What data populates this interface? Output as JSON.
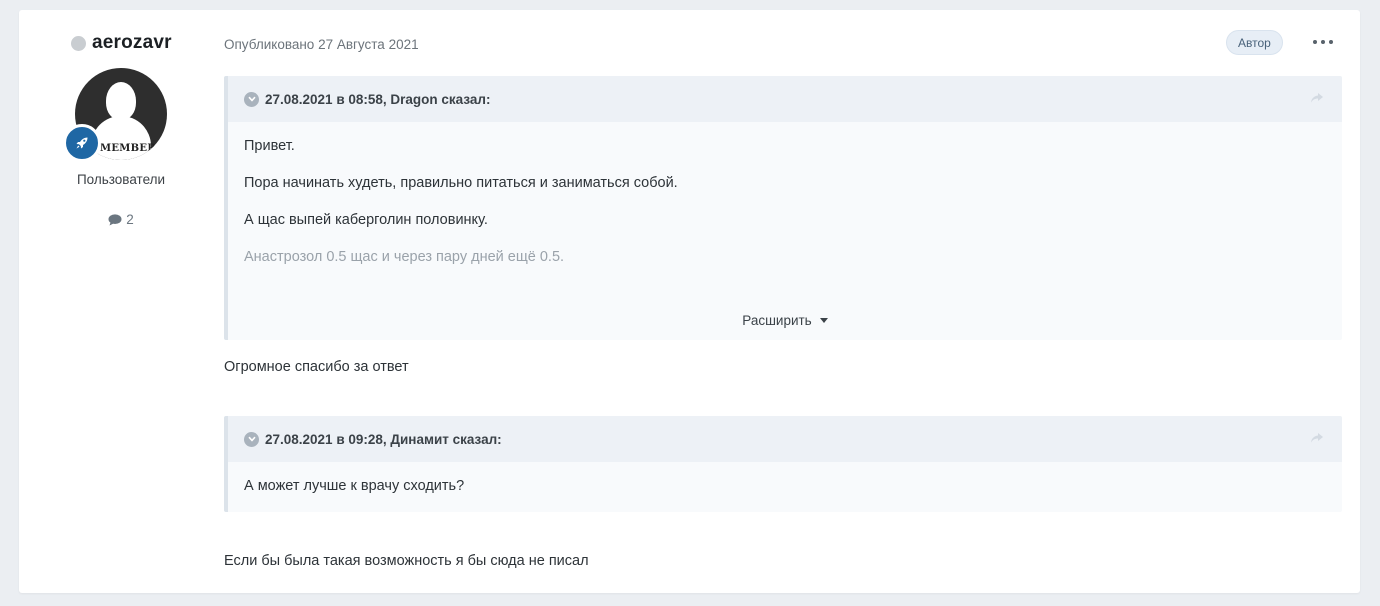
{
  "author": {
    "name": "aerozavr",
    "online_status": "offline",
    "avatar_label": "MEMBER",
    "group": "Пользователи",
    "post_count": "2"
  },
  "post": {
    "date_text": "Опубликовано 27 Августа 2021",
    "author_badge": "Автор",
    "more_icon": "ellipsis-icon"
  },
  "quotes": [
    {
      "cite": "27.08.2021 в 08:58, Dragon сказал:",
      "lines": [
        "Привет.",
        "Пора начинать худеть, правильно питаться и заниматься собой.",
        "А щас выпей каберголин половинку.",
        "Анастрозол 0.5 щас и через пару дней ещё 0.5."
      ],
      "expand_label": "Расширить"
    },
    {
      "cite": "27.08.2021 в 09:28, Динамит сказал:",
      "lines": [
        "А может лучше к врачу сходить?"
      ]
    }
  ],
  "replies": [
    "Огромное спасибо за ответ",
    "Если бы была такая возможность я бы сюда не писал"
  ],
  "colors": {
    "page_bg": "#ebeef2",
    "card_bg": "#ffffff",
    "quote_bg": "#f8fafc",
    "quote_head_bg": "#edf1f6",
    "rank_badge": "#1f67a4"
  }
}
